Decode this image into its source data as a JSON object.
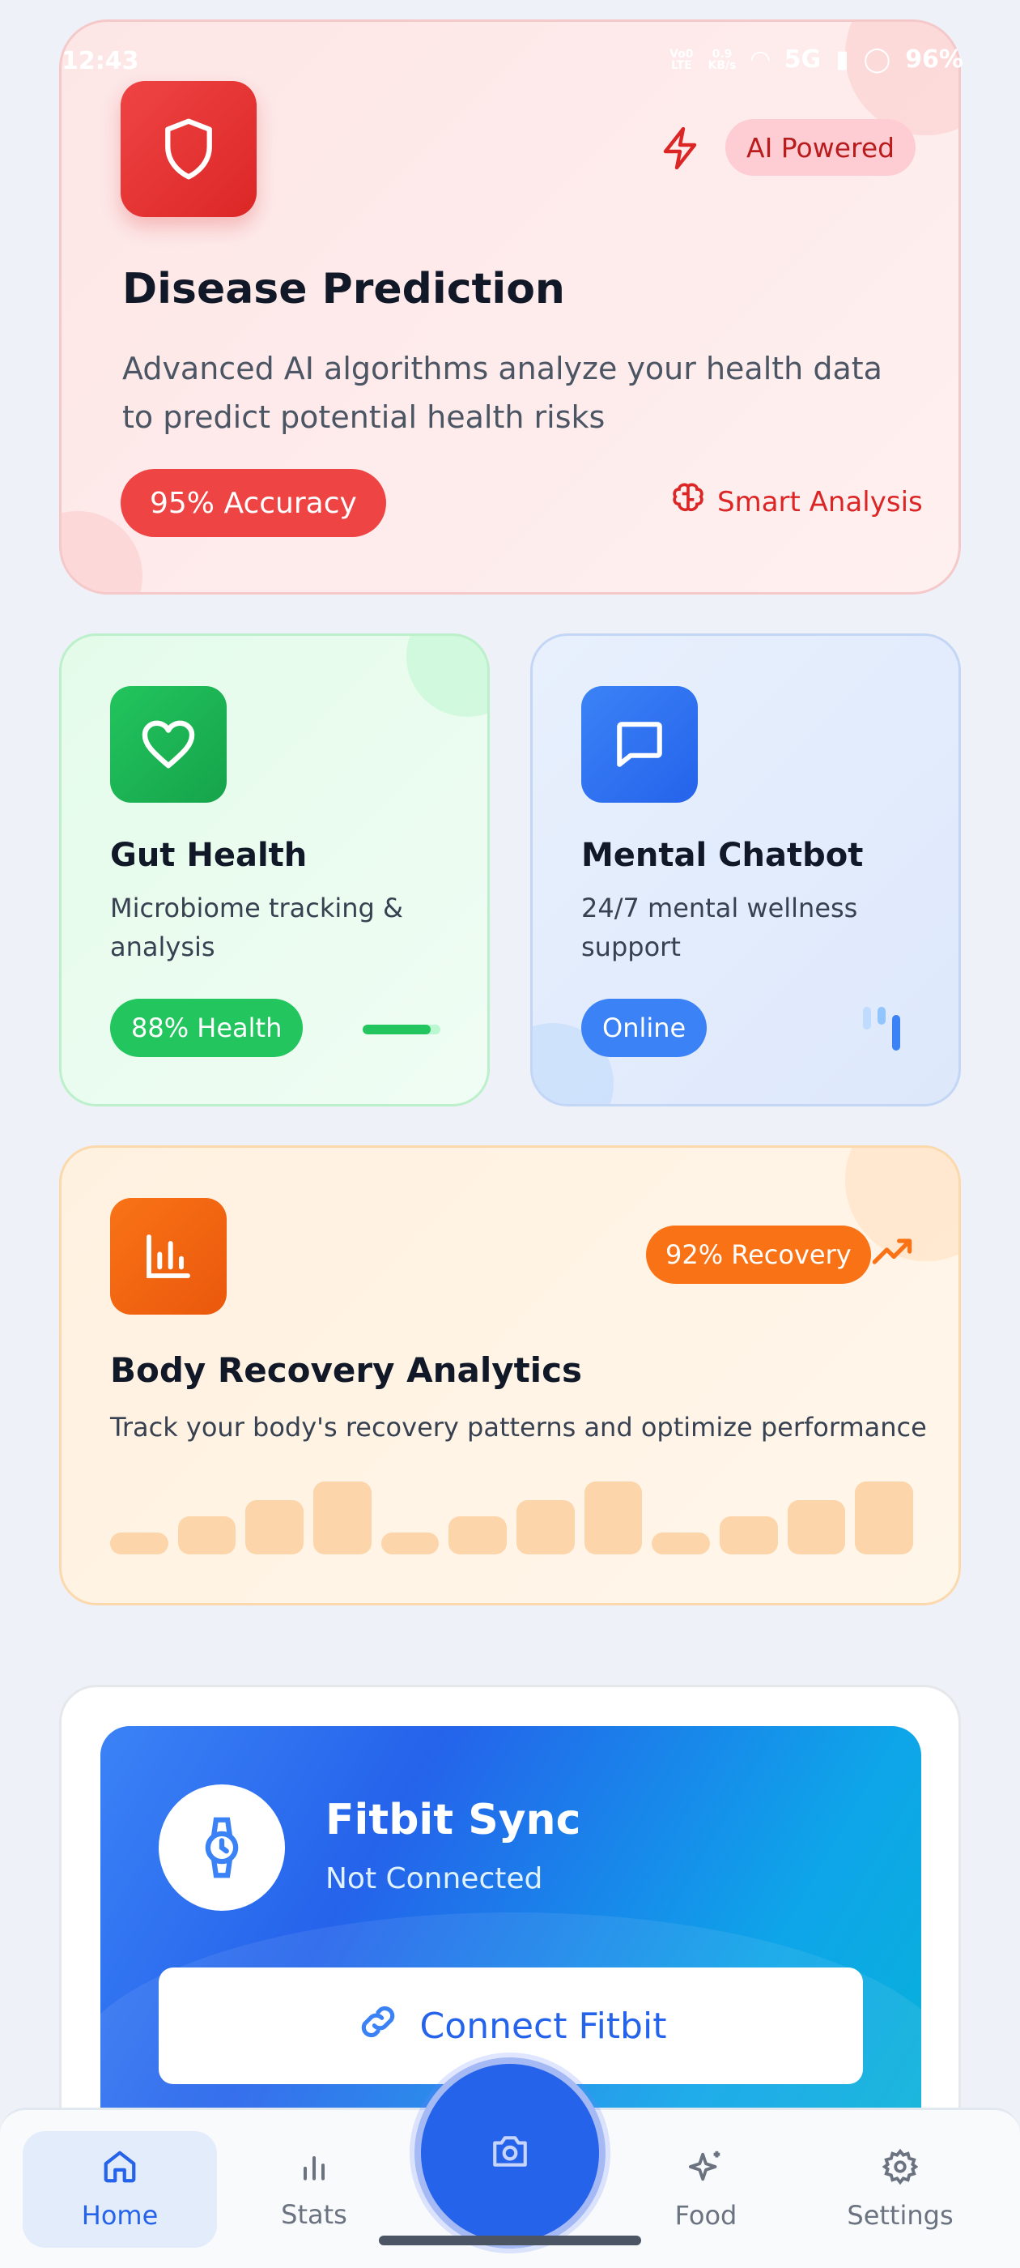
{
  "status_bar": {
    "time": "12:43",
    "network_small_top": "Vo0",
    "network_small_bottom": "LTE",
    "speed_top": "0.9",
    "speed_bottom": "KB/s",
    "signal": "5G",
    "battery": "96%"
  },
  "disease_card": {
    "badge": "AI Powered",
    "title": "Disease Prediction",
    "description": "Advanced AI algorithms analyze your health data to predict potential health risks",
    "accuracy_pill": "95% Accuracy",
    "analysis_label": "Smart Analysis",
    "icons": {
      "main": "shield-icon",
      "badge": "lightning-icon",
      "analysis": "brain-icon"
    }
  },
  "gut_card": {
    "title": "Gut Health",
    "description": "Microbiome tracking & analysis",
    "pill": "88% Health",
    "progress": 0.88,
    "icon": "heart-icon"
  },
  "mental_card": {
    "title": "Mental Chatbot",
    "description": "24/7 mental wellness support",
    "pill": "Online",
    "icon": "chat-bubble-icon"
  },
  "recovery_card": {
    "title": "Body Recovery Analytics",
    "description": "Track your body's recovery patterns and optimize performance",
    "pill": "92% Recovery",
    "icons": {
      "main": "bar-chart-icon",
      "trend": "trending-up-icon"
    }
  },
  "fitbit_card": {
    "title": "Fitbit Sync",
    "status": "Not Connected",
    "button_label": "Connect Fitbit",
    "icons": {
      "main": "watch-icon",
      "button": "link-icon"
    }
  },
  "bottom_nav": {
    "items": [
      {
        "label": "Home",
        "icon": "home-icon",
        "active": true
      },
      {
        "label": "Stats",
        "icon": "stats-icon",
        "active": false
      },
      {
        "label": "Food",
        "icon": "sparkles-icon",
        "active": false
      },
      {
        "label": "Settings",
        "icon": "gear-icon",
        "active": false
      }
    ],
    "center_icon": "camera-icon"
  },
  "colors": {
    "red": "#ef4444",
    "green": "#22c55e",
    "blue": "#3b82f6",
    "orange": "#f97316",
    "nav_active": "#2563eb"
  }
}
